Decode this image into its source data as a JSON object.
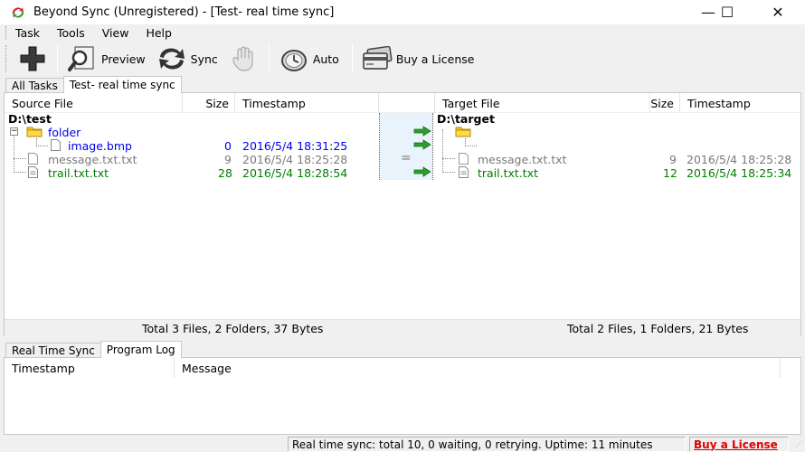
{
  "window": {
    "title": "Beyond Sync (Unregistered) - [Test- real time sync]",
    "minimize": "—",
    "maximize": "☐",
    "close": "✕"
  },
  "menu": [
    "Task",
    "Tools",
    "View",
    "Help"
  ],
  "toolbar": {
    "preview": "Preview",
    "sync": "Sync",
    "auto": "Auto",
    "buy": "Buy a License"
  },
  "task_tabs": [
    "All Tasks",
    "Test- real time sync"
  ],
  "source": {
    "headers": {
      "file": "Source File",
      "size": "Size",
      "timestamp": "Timestamp"
    },
    "root": "D:\\test",
    "rows": [
      {
        "name": "folder",
        "size": "",
        "timestamp": ""
      },
      {
        "name": "image.bmp",
        "size": "0",
        "timestamp": "2016/5/4 18:31:25"
      },
      {
        "name": "message.txt.txt",
        "size": "9",
        "timestamp": "2016/5/4 18:25:28"
      },
      {
        "name": "trail.txt.txt",
        "size": "28",
        "timestamp": "2016/5/4 18:28:54"
      }
    ],
    "total": "Total 3 Files, 2 Folders, 37 Bytes"
  },
  "compare": {
    "equal_symbol": "="
  },
  "target": {
    "headers": {
      "file": "Target File",
      "size": "Size",
      "timestamp": "Timestamp"
    },
    "root": "D:\\target",
    "rows": [
      {
        "name": "message.txt.txt",
        "size": "9",
        "timestamp": "2016/5/4 18:25:28"
      },
      {
        "name": "trail.txt.txt",
        "size": "12",
        "timestamp": "2016/5/4 18:25:34"
      }
    ],
    "total": "Total 2 Files, 1 Folders, 21 Bytes"
  },
  "log_tabs": [
    "Real Time Sync",
    "Program Log"
  ],
  "log": {
    "headers": {
      "timestamp": "Timestamp",
      "message": "Message"
    }
  },
  "status": {
    "text": "Real time sync: total 10, 0 waiting, 0 retrying. Uptime:  11 minutes",
    "buy": "Buy a License"
  },
  "colors": {
    "new_file": "#0000ee",
    "same_file": "#7a7a7a",
    "changed_file": "#008000",
    "arrow": "#2e9e2e",
    "buy_link": "#e00000"
  }
}
